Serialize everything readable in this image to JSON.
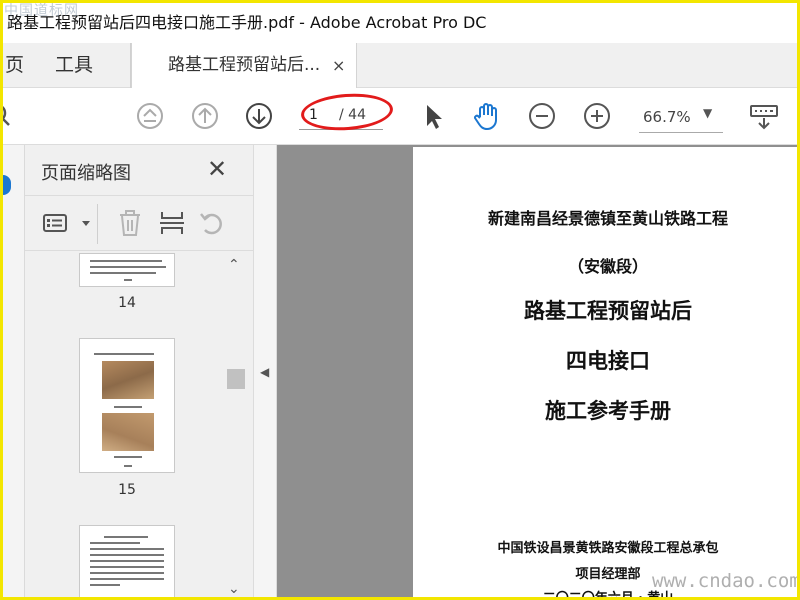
{
  "window": {
    "title": "路基工程预留站后四电接口施工手册.pdf - Adobe Acrobat Pro DC"
  },
  "tabs": {
    "home": "页",
    "tools": "工具",
    "document": "路基工程预留站后...",
    "close_glyph": "×"
  },
  "toolbar": {
    "page_current": "1",
    "page_total": "/ 44",
    "zoom": "66.7%",
    "icons": [
      "prev-first-icon",
      "page-up-icon",
      "page-down-icon",
      "select-arrow-icon",
      "hand-tool-icon",
      "zoom-out-icon",
      "zoom-in-icon",
      "keyboard-icon"
    ],
    "accent": "#1c77d0",
    "annotation_color": "#e21b1b"
  },
  "thumbnails": {
    "title": "页面缩略图",
    "close_glyph": "✕",
    "pages": [
      {
        "number": "14"
      },
      {
        "number": "15"
      }
    ]
  },
  "document": {
    "lines": [
      "新建南昌经景德镇至黄山铁路工程",
      "（安徽段）",
      "路基工程预留站后",
      "四电接口",
      "施工参考手册",
      "中国铁设昌景黄铁路安徽段工程总承包",
      "项目经理部",
      "二〇二〇年六月 · 黄山"
    ]
  },
  "watermarks": {
    "top": "中国道标网",
    "bottom": "www.cndao.com"
  },
  "frame_color": "#f3e600"
}
